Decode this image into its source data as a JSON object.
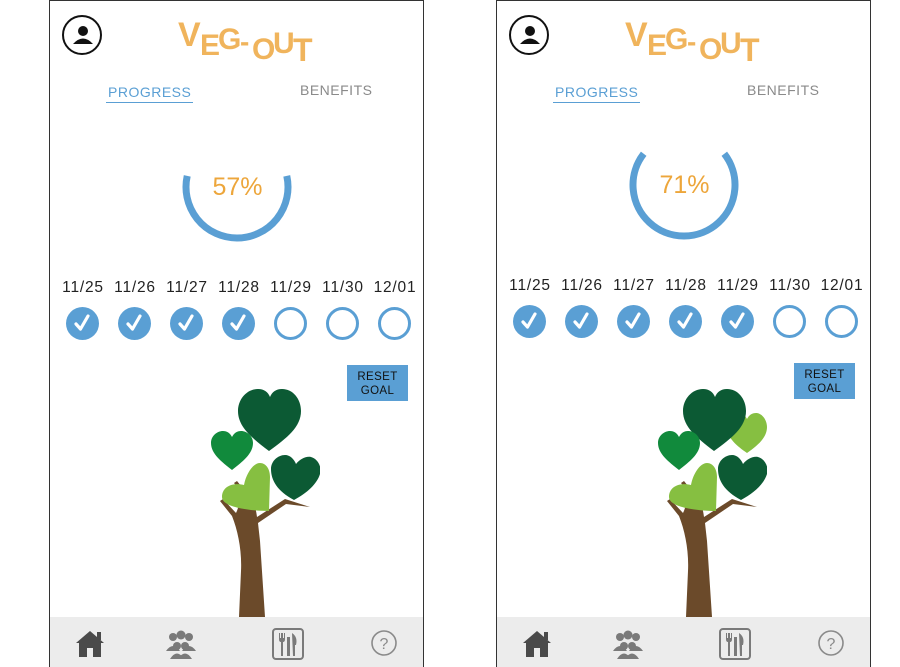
{
  "app": {
    "logo_text": "VEG-OUT",
    "logo_color": "#f0b45c"
  },
  "tabs": {
    "progress": "PROGRESS",
    "benefits": "BENEFITS"
  },
  "colors": {
    "accent_blue": "#5a9fd4",
    "percent_orange": "#eda63b",
    "dark_green": "#0c5a34",
    "mid_green": "#118a3c",
    "light_green": "#86bf41",
    "trunk_brown": "#6b4a2a"
  },
  "screens": [
    {
      "progress": 0.57,
      "percent_label": "57%",
      "dates": [
        "11/25",
        "11/26",
        "11/27",
        "11/28",
        "11/29",
        "11/30",
        "12/01"
      ],
      "checked": [
        true,
        true,
        true,
        true,
        false,
        false,
        false
      ],
      "reset_button": {
        "line1": "RESET",
        "line2": "GOAL"
      },
      "hearts": [
        "dark-green",
        "mid-green",
        "light-green",
        "dark-green"
      ]
    },
    {
      "progress": 0.71,
      "percent_label": "71%",
      "dates": [
        "11/25",
        "11/26",
        "11/27",
        "11/28",
        "11/29",
        "11/30",
        "12/01"
      ],
      "checked": [
        true,
        true,
        true,
        true,
        true,
        false,
        false
      ],
      "reset_button": {
        "line1": "RESET",
        "line2": "GOAL"
      },
      "hearts": [
        "dark-green",
        "mid-green",
        "light-green",
        "dark-green",
        "light-green"
      ]
    }
  ],
  "navbar": {
    "items": [
      "home-icon",
      "community-icon",
      "meals-icon",
      "help-icon"
    ]
  }
}
